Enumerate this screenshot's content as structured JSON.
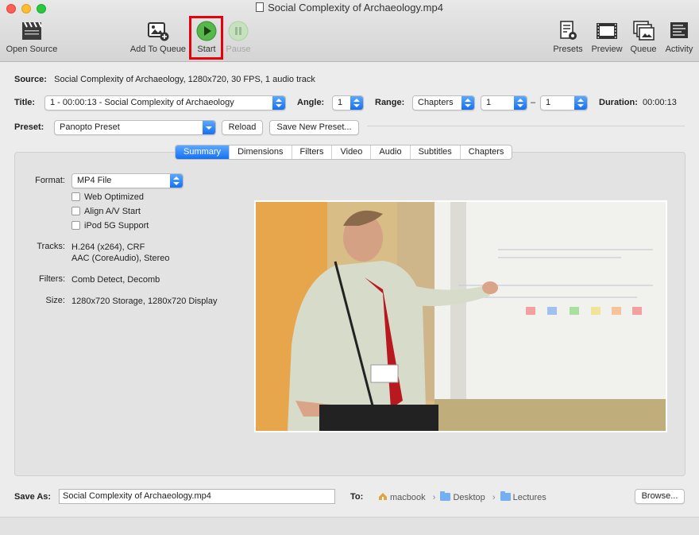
{
  "window": {
    "title": "Social Complexity of Archaeology.mp4"
  },
  "toolbar": {
    "open_source": "Open Source",
    "add_to_queue": "Add To Queue",
    "start": "Start",
    "pause": "Pause",
    "presets": "Presets",
    "preview": "Preview",
    "queue": "Queue",
    "activity": "Activity"
  },
  "source": {
    "label": "Source:",
    "value": "Social Complexity of Archaeology, 1280x720, 30 FPS, 1 audio track"
  },
  "title_row": {
    "title_label": "Title:",
    "title_value": "1 - 00:00:13 - Social Complexity of Archaeology",
    "angle_label": "Angle:",
    "angle_value": "1",
    "range_label": "Range:",
    "range_type": "Chapters",
    "range_start": "1",
    "range_dash": "–",
    "range_end": "1",
    "duration_label": "Duration:",
    "duration_value": "00:00:13"
  },
  "preset": {
    "label": "Preset:",
    "value": "Panopto Preset",
    "reload": "Reload",
    "save_new": "Save New Preset..."
  },
  "tabs": [
    "Summary",
    "Dimensions",
    "Filters",
    "Video",
    "Audio",
    "Subtitles",
    "Chapters"
  ],
  "summary": {
    "format_label": "Format:",
    "format_value": "MP4 File",
    "web_optimized": "Web Optimized",
    "align_av": "Align A/V Start",
    "ipod": "iPod 5G Support",
    "tracks_label": "Tracks:",
    "tracks_line1": "H.264 (x264), CRF",
    "tracks_line2": "AAC (CoreAudio), Stereo",
    "filters_label": "Filters:",
    "filters_value": "Comb Detect, Decomb",
    "size_label": "Size:",
    "size_value": "1280x720 Storage, 1280x720 Display"
  },
  "bottom": {
    "save_as_label": "Save As:",
    "save_as_value": "Social Complexity of Archaeology.mp4",
    "to_label": "To:",
    "path": [
      "macbook",
      "Desktop",
      "Lectures"
    ],
    "browse": "Browse..."
  },
  "colors": {
    "accent": "#1a73f0",
    "start_green": "#3cb043",
    "highlight_box": "#e8000d"
  }
}
